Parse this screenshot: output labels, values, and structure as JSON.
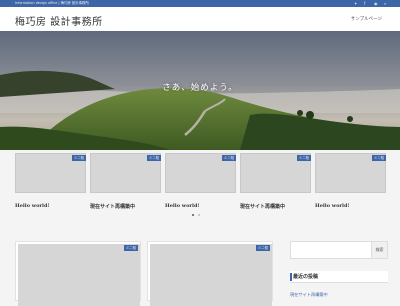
{
  "topbar": {
    "tagline": "Information design office | 梅巧房 設計事務所",
    "icons": [
      "twitter-icon",
      "facebook-icon",
      "rss-icon",
      "search-icon"
    ],
    "color": "#3d66a8"
  },
  "header": {
    "site_title": "梅巧房 設計事務所",
    "nav": [
      {
        "label": "サンプルページ"
      }
    ]
  },
  "hero": {
    "caption": "さあ、始めよう。"
  },
  "carousel": {
    "cards": [
      {
        "badge": "ミニ知",
        "title": "Hello world!"
      },
      {
        "badge": "ミニ知",
        "title": "現在サイト再構築中"
      },
      {
        "badge": "ミニ知",
        "title": "Hello world!"
      },
      {
        "badge": "ミニ知",
        "title": "現在サイト再構築中"
      },
      {
        "badge": "ミニ知",
        "title": "Hello world!"
      }
    ],
    "pages": 2,
    "active_page": 1
  },
  "posts": [
    {
      "badge": "ミニ知"
    },
    {
      "badge": "ミニ知"
    }
  ],
  "sidebar": {
    "search_button": "検索",
    "recent_title": "最近の投稿",
    "recent_items": [
      "現在サイト再構築中"
    ]
  }
}
